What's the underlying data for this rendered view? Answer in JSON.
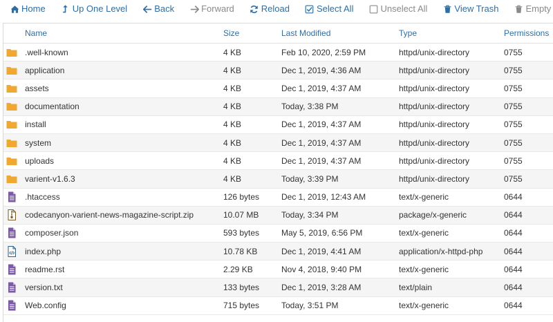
{
  "toolbar": {
    "home": "Home",
    "up_one_level": "Up One Level",
    "back": "Back",
    "forward": "Forward",
    "reload": "Reload",
    "select_all": "Select All",
    "unselect_all": "Unselect All",
    "view_trash": "View Trash",
    "empty_trash": "Empty Trash"
  },
  "columns": {
    "name": "Name",
    "size": "Size",
    "last_modified": "Last Modified",
    "type": "Type",
    "permissions": "Permissions"
  },
  "colors": {
    "accent": "#2d6ea8",
    "folder": "#f0a830",
    "file": "#7b5aa6"
  },
  "files": [
    {
      "icon": "folder-icon",
      "name": ".well-known",
      "size": "4 KB",
      "modified": "Feb 10, 2020, 2:59 PM",
      "type": "httpd/unix-directory",
      "perms": "0755"
    },
    {
      "icon": "folder-icon",
      "name": "application",
      "size": "4 KB",
      "modified": "Dec 1, 2019, 4:36 AM",
      "type": "httpd/unix-directory",
      "perms": "0755"
    },
    {
      "icon": "folder-icon",
      "name": "assets",
      "size": "4 KB",
      "modified": "Dec 1, 2019, 4:37 AM",
      "type": "httpd/unix-directory",
      "perms": "0755"
    },
    {
      "icon": "folder-icon",
      "name": "documentation",
      "size": "4 KB",
      "modified": "Today, 3:38 PM",
      "type": "httpd/unix-directory",
      "perms": "0755"
    },
    {
      "icon": "folder-icon",
      "name": "install",
      "size": "4 KB",
      "modified": "Dec 1, 2019, 4:37 AM",
      "type": "httpd/unix-directory",
      "perms": "0755"
    },
    {
      "icon": "folder-icon",
      "name": "system",
      "size": "4 KB",
      "modified": "Dec 1, 2019, 4:37 AM",
      "type": "httpd/unix-directory",
      "perms": "0755"
    },
    {
      "icon": "folder-icon",
      "name": "uploads",
      "size": "4 KB",
      "modified": "Dec 1, 2019, 4:37 AM",
      "type": "httpd/unix-directory",
      "perms": "0755"
    },
    {
      "icon": "folder-icon",
      "name": "varient-v1.6.3",
      "size": "4 KB",
      "modified": "Today, 3:39 PM",
      "type": "httpd/unix-directory",
      "perms": "0755"
    },
    {
      "icon": "text-file-icon",
      "name": ".htaccess",
      "size": "126 bytes",
      "modified": "Dec 1, 2019, 12:43 AM",
      "type": "text/x-generic",
      "perms": "0644"
    },
    {
      "icon": "zip-file-icon",
      "name": "codecanyon-varient-news-magazine-script.zip",
      "size": "10.07 MB",
      "modified": "Today, 3:34 PM",
      "type": "package/x-generic",
      "perms": "0644"
    },
    {
      "icon": "text-file-icon",
      "name": "composer.json",
      "size": "593 bytes",
      "modified": "May 5, 2019, 6:56 PM",
      "type": "text/x-generic",
      "perms": "0644"
    },
    {
      "icon": "code-file-icon",
      "name": "index.php",
      "size": "10.78 KB",
      "modified": "Dec 1, 2019, 4:41 AM",
      "type": "application/x-httpd-php",
      "perms": "0644"
    },
    {
      "icon": "text-file-icon",
      "name": "readme.rst",
      "size": "2.29 KB",
      "modified": "Nov 4, 2018, 9:40 PM",
      "type": "text/x-generic",
      "perms": "0644"
    },
    {
      "icon": "text-file-icon",
      "name": "version.txt",
      "size": "133 bytes",
      "modified": "Dec 1, 2019, 3:28 AM",
      "type": "text/plain",
      "perms": "0644"
    },
    {
      "icon": "text-file-icon",
      "name": "Web.config",
      "size": "715 bytes",
      "modified": "Today, 3:51 PM",
      "type": "text/x-generic",
      "perms": "0644"
    }
  ]
}
